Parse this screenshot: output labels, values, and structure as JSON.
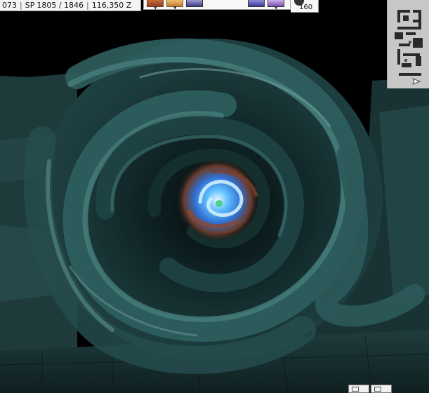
{
  "status": {
    "hp_partial": "073",
    "sp_label": "SP",
    "sp_value": "1805 / 1846",
    "zeny": "116,350 Z"
  },
  "toolbar": {
    "hotkeys": [
      "hotkey-1",
      "hotkey-2",
      "hotkey-3",
      "hotkey-4",
      "hotkey-5"
    ]
  },
  "weight": {
    "value": "160"
  },
  "minimap": {
    "icon": "minimap-map",
    "player_marker": "arrow-marker"
  },
  "bottom_buttons": [
    "window-button-1",
    "window-button-2"
  ],
  "colors": {
    "vortex_teal": "#2e5a5a",
    "vortex_dark": "#0e1a1b",
    "core_blue": "#3aa8ff",
    "core_rust": "#8a4a35",
    "ui_panel": "#f4f4f4"
  }
}
